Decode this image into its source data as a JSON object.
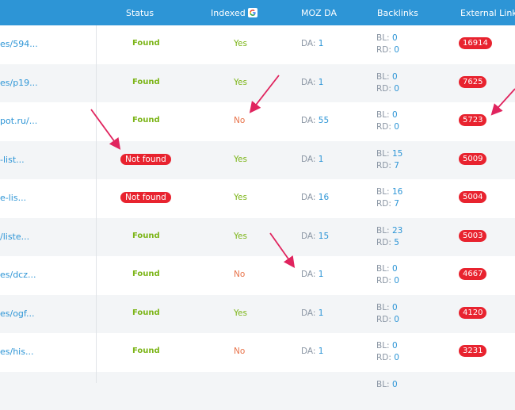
{
  "header": {
    "status": "Status",
    "indexed": "Indexed",
    "moz_da": "MOZ DA",
    "backlinks": "Backlinks",
    "external_links": "External Links"
  },
  "colors": {
    "header_bg": "#2d95d6",
    "found": "#7cb518",
    "not_found": "#e8232f",
    "no": "#e8734a",
    "link": "#2d95d6"
  },
  "rows": [
    {
      "url": "es/594...",
      "status": "Found",
      "indexed": "Yes",
      "da_label": "DA:",
      "da": "1",
      "bl_label": "BL:",
      "bl": "0",
      "rd_label": "RD:",
      "rd": "0",
      "ext": "16914"
    },
    {
      "url": "es/p19...",
      "status": "Found",
      "indexed": "Yes",
      "da_label": "DA:",
      "da": "1",
      "bl_label": "BL:",
      "bl": "0",
      "rd_label": "RD:",
      "rd": "0",
      "ext": "7625"
    },
    {
      "url": "pot.ru/...",
      "status": "Found",
      "indexed": "No",
      "da_label": "DA:",
      "da": "55",
      "bl_label": "BL:",
      "bl": "0",
      "rd_label": "RD:",
      "rd": "0",
      "ext": "5723"
    },
    {
      "url": "-list...",
      "status": "Not found",
      "indexed": "Yes",
      "da_label": "DA:",
      "da": "1",
      "bl_label": "BL:",
      "bl": "15",
      "rd_label": "RD:",
      "rd": "7",
      "ext": "5009"
    },
    {
      "url": "e-lis...",
      "status": "Not found",
      "indexed": "Yes",
      "da_label": "DA:",
      "da": "16",
      "bl_label": "BL:",
      "bl": "16",
      "rd_label": "RD:",
      "rd": "7",
      "ext": "5004"
    },
    {
      "url": "/liste...",
      "status": "Found",
      "indexed": "Yes",
      "da_label": "DA:",
      "da": "15",
      "bl_label": "BL:",
      "bl": "23",
      "rd_label": "RD:",
      "rd": "5",
      "ext": "5003"
    },
    {
      "url": "es/dcz...",
      "status": "Found",
      "indexed": "No",
      "da_label": "DA:",
      "da": "1",
      "bl_label": "BL:",
      "bl": "0",
      "rd_label": "RD:",
      "rd": "0",
      "ext": "4667"
    },
    {
      "url": "es/ogf...",
      "status": "Found",
      "indexed": "Yes",
      "da_label": "DA:",
      "da": "1",
      "bl_label": "BL:",
      "bl": "0",
      "rd_label": "RD:",
      "rd": "0",
      "ext": "4120"
    },
    {
      "url": "es/his...",
      "status": "Found",
      "indexed": "No",
      "da_label": "DA:",
      "da": "1",
      "bl_label": "BL:",
      "bl": "0",
      "rd_label": "RD:",
      "rd": "0",
      "ext": "3231"
    },
    {
      "url": "",
      "status": "",
      "indexed": "",
      "da_label": "",
      "da": "",
      "bl_label": "BL:",
      "bl": "0",
      "rd_label": "",
      "rd": "",
      "ext": ""
    }
  ]
}
